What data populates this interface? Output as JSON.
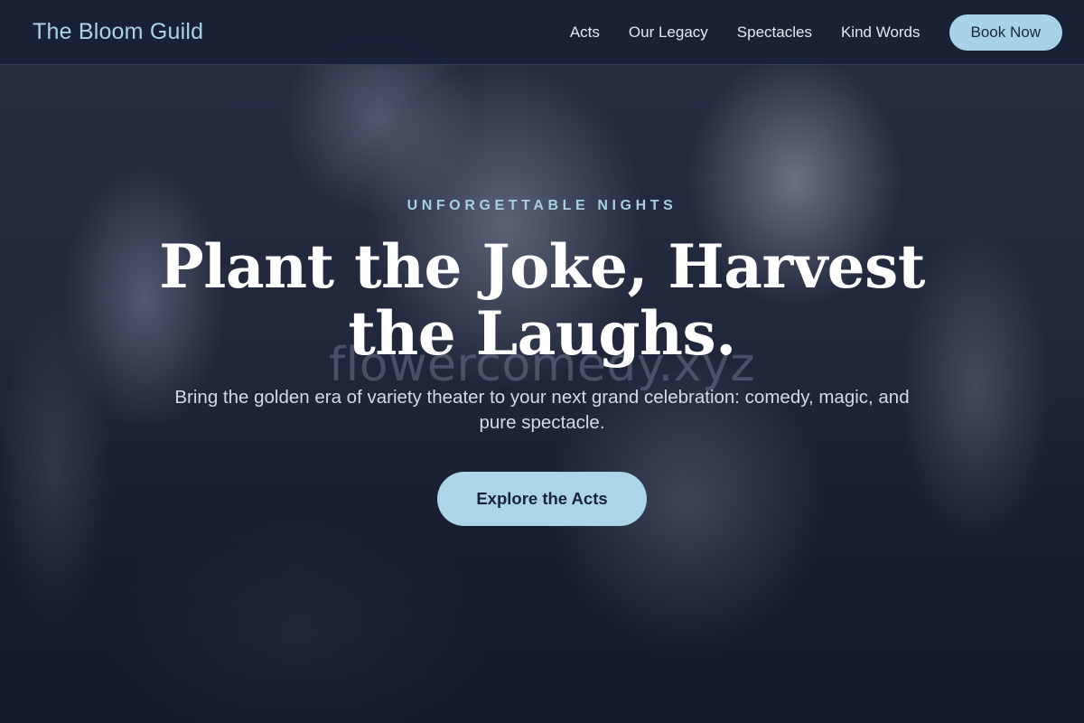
{
  "header": {
    "brand": "The Bloom Guild",
    "nav": [
      {
        "label": "Acts"
      },
      {
        "label": "Our Legacy"
      },
      {
        "label": "Spectacles"
      },
      {
        "label": "Kind Words"
      }
    ],
    "cta_label": "Book Now"
  },
  "hero": {
    "kicker": "UNFORGETTABLE NIGHTS",
    "headline_line1": "Plant the Joke, Harvest",
    "headline_line2": "the Laughs.",
    "subtitle": "Bring the golden era of variety theater to your next grand celebration: comedy, magic, and pure spectacle.",
    "cta_label": "Explore the Acts",
    "watermark": "flowercomedy.xyz"
  },
  "colors": {
    "accent": "#a8d3e6",
    "header_bg": "#182134",
    "hero_bg": "#1c2236",
    "text_light": "#ffffff"
  }
}
